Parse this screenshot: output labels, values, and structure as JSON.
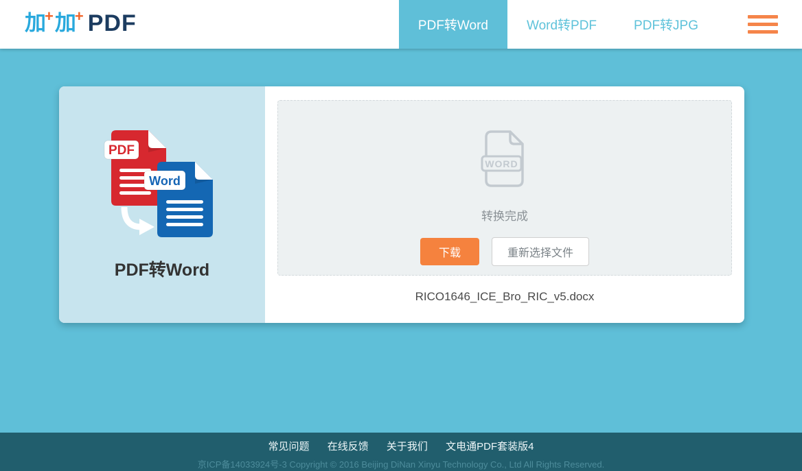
{
  "header": {
    "logo": {
      "jia1": "加",
      "plus1": "+",
      "jia2": "加",
      "plus2": "+",
      "suffix": "PDF"
    },
    "nav": [
      {
        "label": "PDF转Word",
        "active": true
      },
      {
        "label": "Word转PDF",
        "active": false
      },
      {
        "label": "PDF转JPG",
        "active": false
      }
    ]
  },
  "panel": {
    "title": "PDF转Word",
    "pdf_badge": "PDF",
    "word_badge": "Word"
  },
  "dropzone": {
    "file_icon_label": "WORD",
    "status": "转换完成",
    "download_button": "下载",
    "reselect_button": "重新选择文件"
  },
  "result": {
    "filename": "RICO1646_ICE_Bro_RIC_v5.docx"
  },
  "footer": {
    "links": [
      "常见问题",
      "在线反馈",
      "关于我们",
      "文电通PDF套装版4"
    ],
    "copyright": "京ICP备14033924号-3 Copyright © 2016 Beijing DiNan Xinyu Technology Co., Ltd All Rights Reserved."
  },
  "colors": {
    "theme_blue": "#5fbfd8",
    "accent_orange": "#f5823e",
    "footer_teal": "#215e6d",
    "panel_light_blue": "#c7e4ee",
    "pdf_red": "#d7282f",
    "word_blue": "#1467b3",
    "logo_navy": "#1c3c60"
  }
}
